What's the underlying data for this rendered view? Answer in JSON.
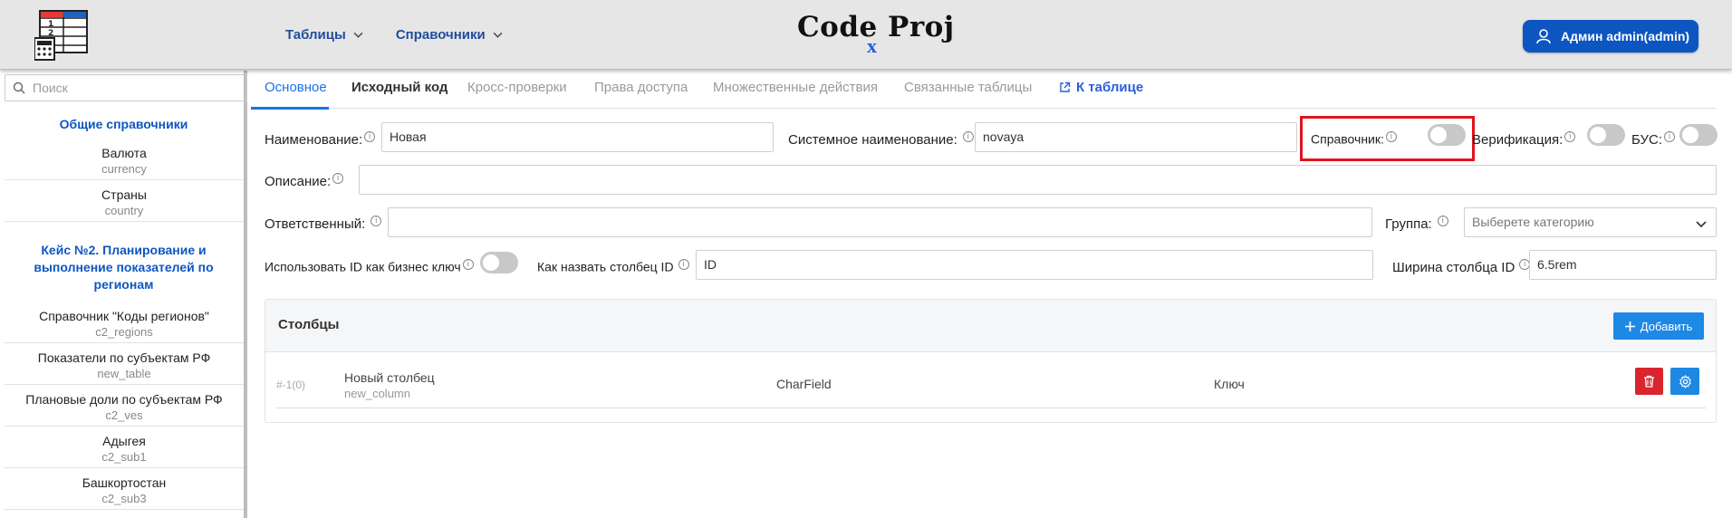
{
  "header": {
    "nav": [
      {
        "label": "Таблицы"
      },
      {
        "label": "Справочники"
      }
    ],
    "brand": {
      "text": "Code Proj",
      "accent": "x"
    },
    "user": {
      "label": "Админ admin(admin)"
    }
  },
  "sidebar": {
    "search_placeholder": "Поиск",
    "groups": [
      {
        "title": "Общие справочники"
      },
      {
        "title": "Кейс №2. Планирование и выполнение показателей по регионам"
      }
    ],
    "items": [
      {
        "title": "Валюта",
        "sub": "currency"
      },
      {
        "title": "Страны",
        "sub": "country"
      },
      {
        "title": "Справочник \"Коды регионов\"",
        "sub": "c2_regions"
      },
      {
        "title": "Показатели по субъектам РФ",
        "sub": "new_table"
      },
      {
        "title": "Плановые доли по субъектам РФ",
        "sub": "c2_ves"
      },
      {
        "title": "Адыгея",
        "sub": "c2_sub1"
      },
      {
        "title": "Башкортостан",
        "sub": "c2_sub3"
      }
    ]
  },
  "tabs": [
    {
      "label": "Основное"
    },
    {
      "label": "Исходный код"
    },
    {
      "label": "Кросс-проверки"
    },
    {
      "label": "Права доступа"
    },
    {
      "label": "Множественные действия"
    },
    {
      "label": "Связанные таблицы"
    },
    {
      "label": "К таблице"
    }
  ],
  "form": {
    "name_label": "Наименование:",
    "name_value": "Новая",
    "sysname_label": "Системное наименование:",
    "sysname_value": "novaya",
    "directory_label": "Справочник:",
    "verification_label": "Верификация:",
    "bus_label": "БУС:",
    "description_label": "Описание:",
    "description_value": "",
    "responsible_label": "Ответственный:",
    "responsible_value": "",
    "group_label": "Группа:",
    "group_placeholder": "Выберете категорию",
    "use_id_label": "Использовать ID как бизнес ключ",
    "id_col_name_label": "Как назвать столбец ID",
    "id_col_name_value": "ID",
    "id_col_width_label": "Ширина столбца ID",
    "id_col_width_value": "6.5rem",
    "info_glyph": "i"
  },
  "columns": {
    "title": "Столбцы",
    "add_label": "Добавить",
    "rows": [
      {
        "num": "#-1(0)",
        "name": "Новый столбец",
        "sys": "new_column",
        "type": "CharField",
        "key": "Ключ"
      }
    ]
  },
  "colors": {
    "primary": "#0d56c2",
    "accent": "#1a73e8",
    "danger": "#d9262e",
    "highlight": "#e0141e"
  }
}
